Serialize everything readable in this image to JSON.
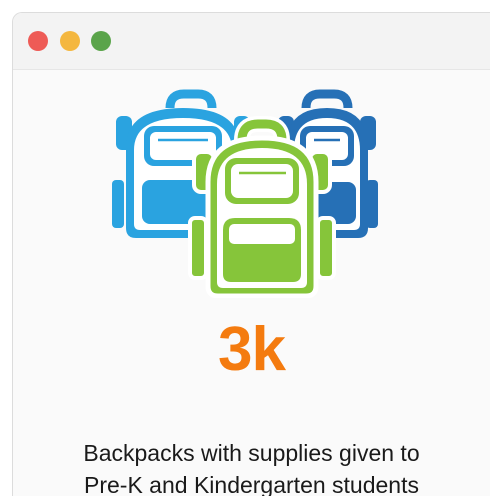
{
  "window": {
    "controls": {
      "close_color": "#ee5b56",
      "minimize_color": "#f4b73f",
      "maximize_color": "#5aa44a"
    }
  },
  "illustration": {
    "icons": [
      "backpack-icon-blue",
      "backpack-icon-blue",
      "backpack-icon-green"
    ],
    "colors": {
      "light_blue": "#2aa3e0",
      "dark_blue": "#2670b6",
      "green": "#86c53a",
      "outline_white": "#ffffff"
    }
  },
  "stat": {
    "value": "3k",
    "color": "#f47b0f"
  },
  "caption": {
    "line1": "Backpacks with supplies given to",
    "line2": "Pre-K and Kindergarten students"
  }
}
